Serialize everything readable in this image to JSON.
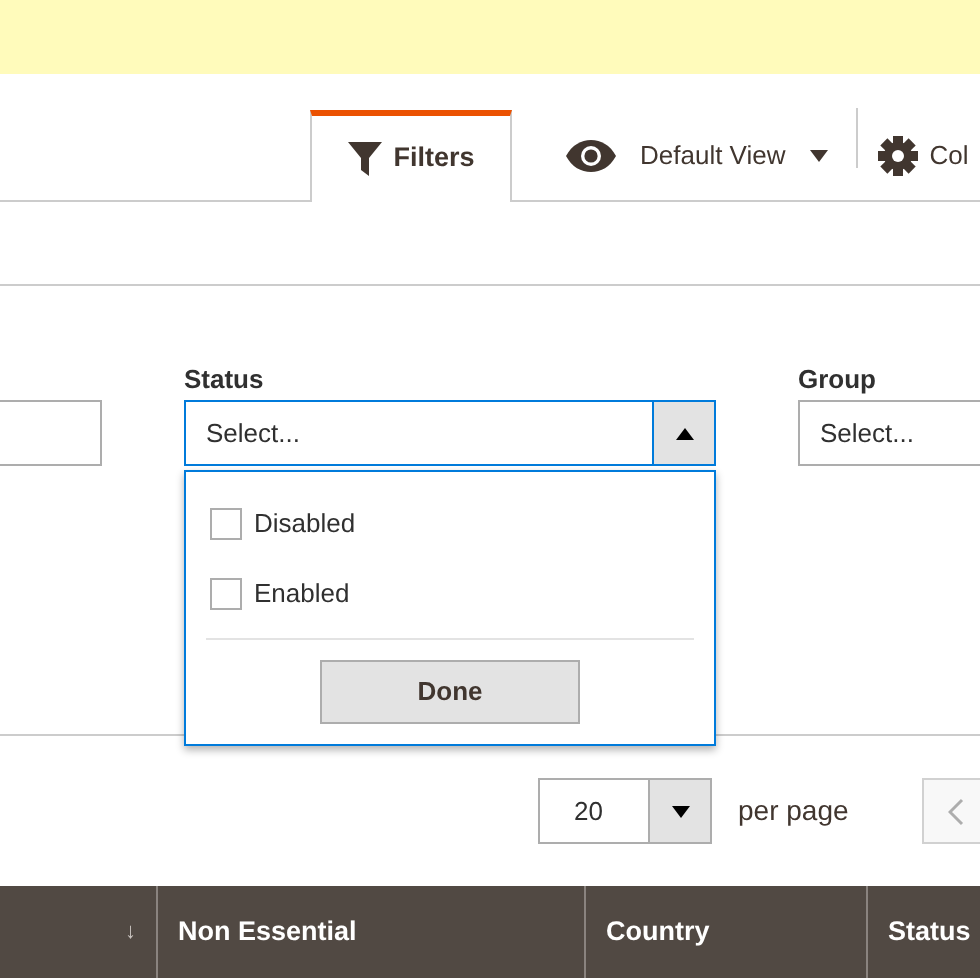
{
  "toolbar": {
    "tabs": [
      {
        "label": "Filters",
        "selected": true
      }
    ],
    "view_switcher": {
      "label": "Default View"
    },
    "columns_control": {
      "label": "Col"
    }
  },
  "filters": [
    {
      "kind": "text"
    },
    {
      "kind": "select",
      "label": "Status",
      "placeholder": "Select...",
      "expanded": true,
      "options": [
        {
          "label": "Disabled",
          "checked": false
        },
        {
          "label": "Enabled",
          "checked": false
        }
      ],
      "done_button": "Done"
    },
    {
      "kind": "select",
      "label": "Group",
      "placeholder": "Select...",
      "expanded": false
    }
  ],
  "pagination": {
    "per_page": "20",
    "per_page_label": "per page"
  },
  "table": {
    "columns": [
      {
        "sort_mark": "↓"
      },
      {
        "label": "Non Essential"
      },
      {
        "label": "Country"
      },
      {
        "label": "Status"
      }
    ]
  }
}
